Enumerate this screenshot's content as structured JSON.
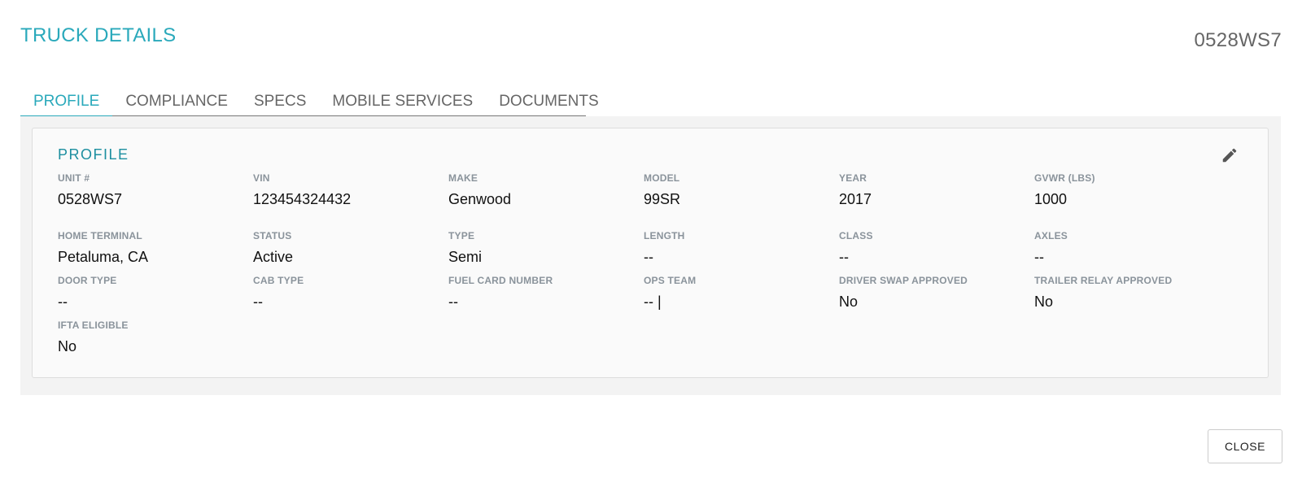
{
  "header": {
    "title": "TRUCK DETAILS",
    "unit_id": "0528WS7"
  },
  "tabs": [
    {
      "label": "PROFILE",
      "active": true
    },
    {
      "label": "COMPLIANCE",
      "active": false
    },
    {
      "label": "SPECS",
      "active": false
    },
    {
      "label": "MOBILE SERVICES",
      "active": false
    },
    {
      "label": "DOCUMENTS",
      "active": false
    }
  ],
  "profile": {
    "title": "PROFILE",
    "edit_icon": "pencil-icon",
    "fields": {
      "unit": {
        "label": "UNIT #",
        "value": "0528WS7"
      },
      "vin": {
        "label": "VIN",
        "value": "123454324432"
      },
      "make": {
        "label": "MAKE",
        "value": "Genwood"
      },
      "model": {
        "label": "MODEL",
        "value": "99SR"
      },
      "year": {
        "label": "YEAR",
        "value": "2017"
      },
      "gvwr": {
        "label": "GVWR (LBS)",
        "value": "1000"
      },
      "home_terminal": {
        "label": "HOME TERMINAL",
        "value": "Petaluma, CA"
      },
      "status": {
        "label": "STATUS",
        "value": "Active"
      },
      "type": {
        "label": "TYPE",
        "value": "Semi"
      },
      "length": {
        "label": "LENGTH",
        "value": "--"
      },
      "class": {
        "label": "CLASS",
        "value": "--"
      },
      "axles": {
        "label": "AXLES",
        "value": "--"
      },
      "door_type": {
        "label": "DOOR TYPE",
        "value": "--"
      },
      "cab_type": {
        "label": "CAB TYPE",
        "value": "--"
      },
      "fuel_card_number": {
        "label": "FUEL CARD NUMBER",
        "value": "--"
      },
      "ops_team": {
        "label": "OPS TEAM",
        "value": "-- |"
      },
      "driver_swap_approved": {
        "label": "DRIVER SWAP APPROVED",
        "value": "No"
      },
      "trailer_relay_approved": {
        "label": "TRAILER RELAY APPROVED",
        "value": "No"
      },
      "ifta_eligible": {
        "label": "IFTA ELIGIBLE",
        "value": "No"
      }
    }
  },
  "footer": {
    "close_label": "CLOSE"
  }
}
